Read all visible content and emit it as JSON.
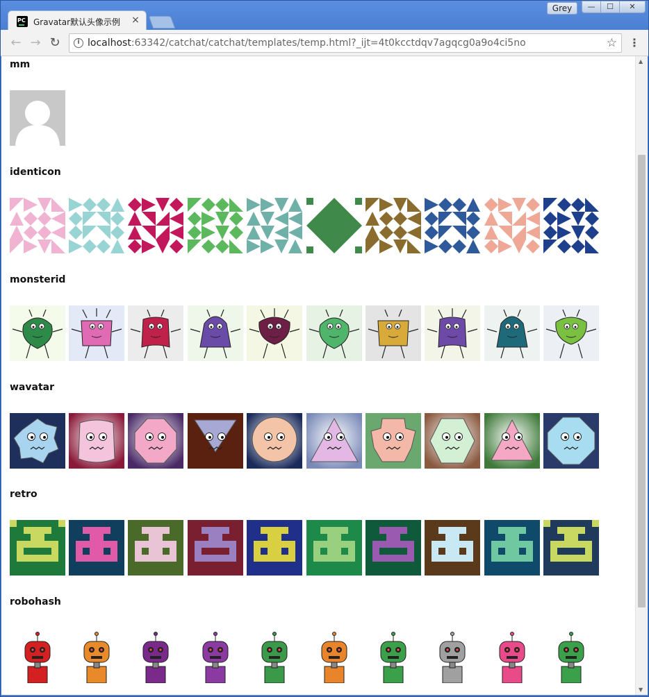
{
  "browser": {
    "tab_title": "Gravatar默认头像示例",
    "tab_close": "×",
    "user_badge": "Grey",
    "window_buttons": {
      "minimize": "—",
      "maximize": "☐",
      "close": "✕"
    },
    "url_host": "localhost",
    "url_rest": ":63342/catchat/catchat/templates/temp.html?_ijt=4t0kcctdqv7agqcg0a9o4ci5no",
    "nav": {
      "back": "←",
      "forward": "→",
      "reload": "↻"
    },
    "star": "☆",
    "menu": "⋮"
  },
  "sections": [
    {
      "id": "mm",
      "title": "mm",
      "count": 1
    },
    {
      "id": "identicon",
      "title": "identicon",
      "count": 10
    },
    {
      "id": "monsterid",
      "title": "monsterid",
      "count": 10
    },
    {
      "id": "wavatar",
      "title": "wavatar",
      "count": 10
    },
    {
      "id": "retro",
      "title": "retro",
      "count": 10
    },
    {
      "id": "robohash",
      "title": "robohash",
      "count": 10
    }
  ],
  "colors": {
    "identicon": [
      "#f0b3d1",
      "#99d4d4",
      "#c2185b",
      "#5cb85c",
      "#6fb0a8",
      "#3f8a4a",
      "#8a6d2e",
      "#2e5a9c",
      "#f0a896",
      "#1e3f8c"
    ],
    "monsterid_bg": [
      "#f5fbea",
      "#e4e9f7",
      "#ececec",
      "#eef7ea",
      "#f3f7e3",
      "#e6f2e3",
      "#e4e4e4",
      "#f2f5e8",
      "#eef2f0",
      "#eceff4"
    ],
    "monsterid_body": [
      "#2e8a48",
      "#e06ab3",
      "#c0214a",
      "#6a4ba8",
      "#6d1f45",
      "#4fb56a",
      "#d8aa3a",
      "#6d4aa8",
      "#1f6a7a",
      "#7ac142"
    ],
    "wavatar_bg": [
      "#1e2f5c",
      "#8b1a3a",
      "#4a2a66",
      "#5a2010",
      "#1a2a5a",
      "#7a8ab8",
      "#6aa870",
      "#8a5a40",
      "#3f7a3a",
      "#2a3a6a"
    ],
    "wavatar_face": [
      "#a8d4f0",
      "#f4c4dc",
      "#f4a8c8",
      "#a8a8d4",
      "#f4c4a8",
      "#e4b8e4",
      "#f4b8a8",
      "#d4f0d4",
      "#f4a8c4",
      "#a8dcf0"
    ],
    "retro_bg": [
      "#1e7a3a",
      "#0f3f5c",
      "#4a6a2a",
      "#7a1f2f",
      "#1f2f8a",
      "#1e8a4a",
      "#0f5a3a",
      "#5a3a1a",
      "#0f4a6a",
      "#1f3a5a"
    ],
    "retro_fg": [
      "#c8d860",
      "#e05aa8",
      "#e8c4d4",
      "#9a80c0",
      "#d8d040",
      "#98d080",
      "#9a5ab0",
      "#c8e8f4",
      "#70c8a0",
      "#c8d860"
    ],
    "robohash": [
      "#d42020",
      "#e88a2a",
      "#7a2a8a",
      "#8a3aa0",
      "#3a9a4a",
      "#e8842a",
      "#3aa04a",
      "#a0a0a0",
      "#e84a8a",
      "#3aa04a"
    ]
  }
}
